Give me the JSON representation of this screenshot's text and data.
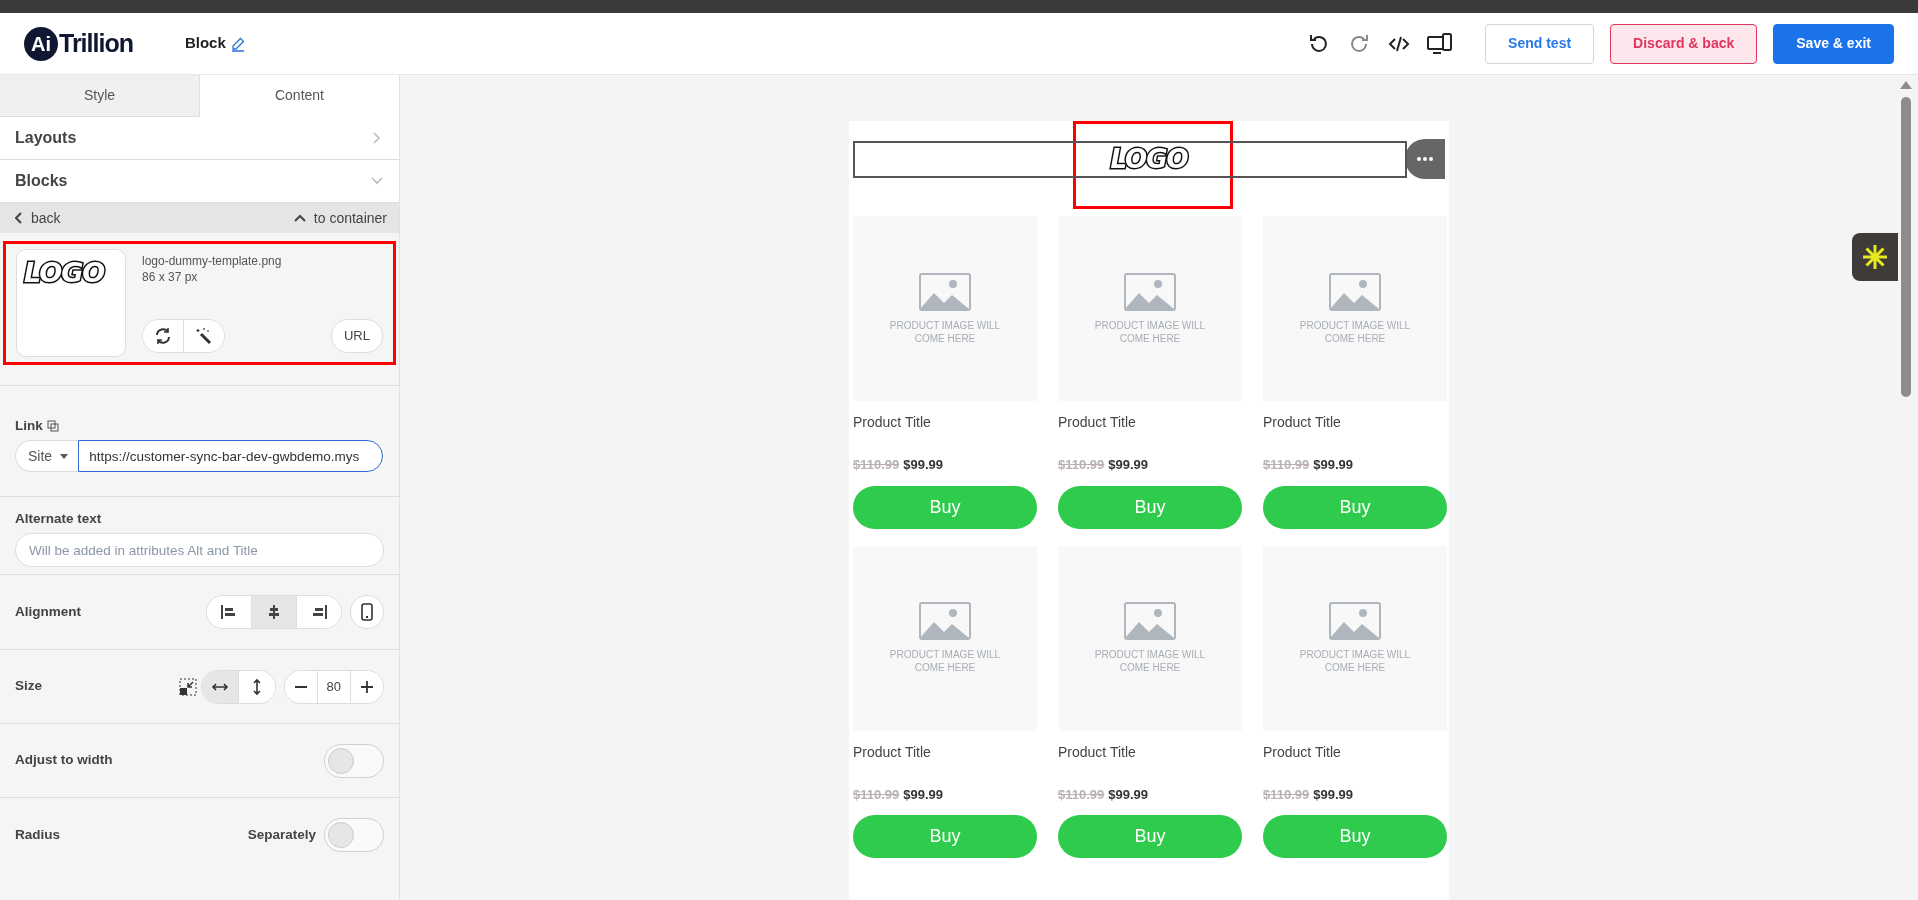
{
  "header": {
    "brand_mark": "Ai",
    "brand_name": "Trillion",
    "title": "Block",
    "buttons": [
      {
        "label": "Send test",
        "kind": "outline"
      },
      {
        "label": "Discard & back",
        "kind": "danger"
      },
      {
        "label": "Save & exit",
        "kind": "primary"
      }
    ]
  },
  "panel": {
    "tabs": [
      {
        "label": "Style",
        "selected": false
      },
      {
        "label": "Content",
        "selected": true
      }
    ],
    "sections": [
      {
        "label": "Layouts",
        "expanded": false
      },
      {
        "label": "Blocks",
        "expanded": true
      }
    ],
    "nav": {
      "back": "back",
      "up": "to container"
    },
    "image": {
      "logo_text": "LOGO",
      "file_name": "logo-dummy-template.png",
      "dimensions": "86 x 37 px",
      "url_button": "URL",
      "highlighted": true
    },
    "link": {
      "label": "Link",
      "type": "Site",
      "value": "https://customer-sync-bar-dev-gwbdemo.mys"
    },
    "alt_text": {
      "label": "Alternate text",
      "placeholder": "Will be added in attributes Alt and Title"
    },
    "alignment": {
      "label": "Alignment",
      "options": [
        {
          "kind": "left",
          "selected": false
        },
        {
          "kind": "center",
          "selected": true
        },
        {
          "kind": "right",
          "selected": false
        }
      ]
    },
    "size": {
      "label": "Size",
      "modes": [
        {
          "kind": "width",
          "selected": true
        },
        {
          "kind": "height",
          "selected": false
        }
      ],
      "value": "80"
    },
    "adjust": {
      "label": "Adjust to width",
      "on": false
    },
    "radius": {
      "label": "Radius",
      "option": "Separately",
      "on": false
    }
  },
  "canvas": {
    "logo_block": {
      "logo_text": "LOGO",
      "highlighted": true
    },
    "products": [
      {
        "placeholder": "PRODUCT IMAGE WILL COME HERE",
        "title": "Product Title",
        "old_price": "$110.99",
        "price": "$99.99",
        "button": "Buy"
      },
      {
        "placeholder": "PRODUCT IMAGE WILL COME HERE",
        "title": "Product Title",
        "old_price": "$110.99",
        "price": "$99.99",
        "button": "Buy"
      },
      {
        "placeholder": "PRODUCT IMAGE WILL COME HERE",
        "title": "Product Title",
        "old_price": "$110.99",
        "price": "$99.99",
        "button": "Buy"
      },
      {
        "placeholder": "PRODUCT IMAGE WILL COME HERE",
        "title": "Product Title",
        "old_price": "$110.99",
        "price": "$99.99",
        "button": "Buy"
      },
      {
        "placeholder": "PRODUCT IMAGE WILL COME HERE",
        "title": "Product Title",
        "old_price": "$110.99",
        "price": "$99.99",
        "button": "Buy"
      },
      {
        "placeholder": "PRODUCT IMAGE WILL COME HERE",
        "title": "Product Title",
        "old_price": "$110.99",
        "price": "$99.99",
        "button": "Buy"
      }
    ]
  }
}
